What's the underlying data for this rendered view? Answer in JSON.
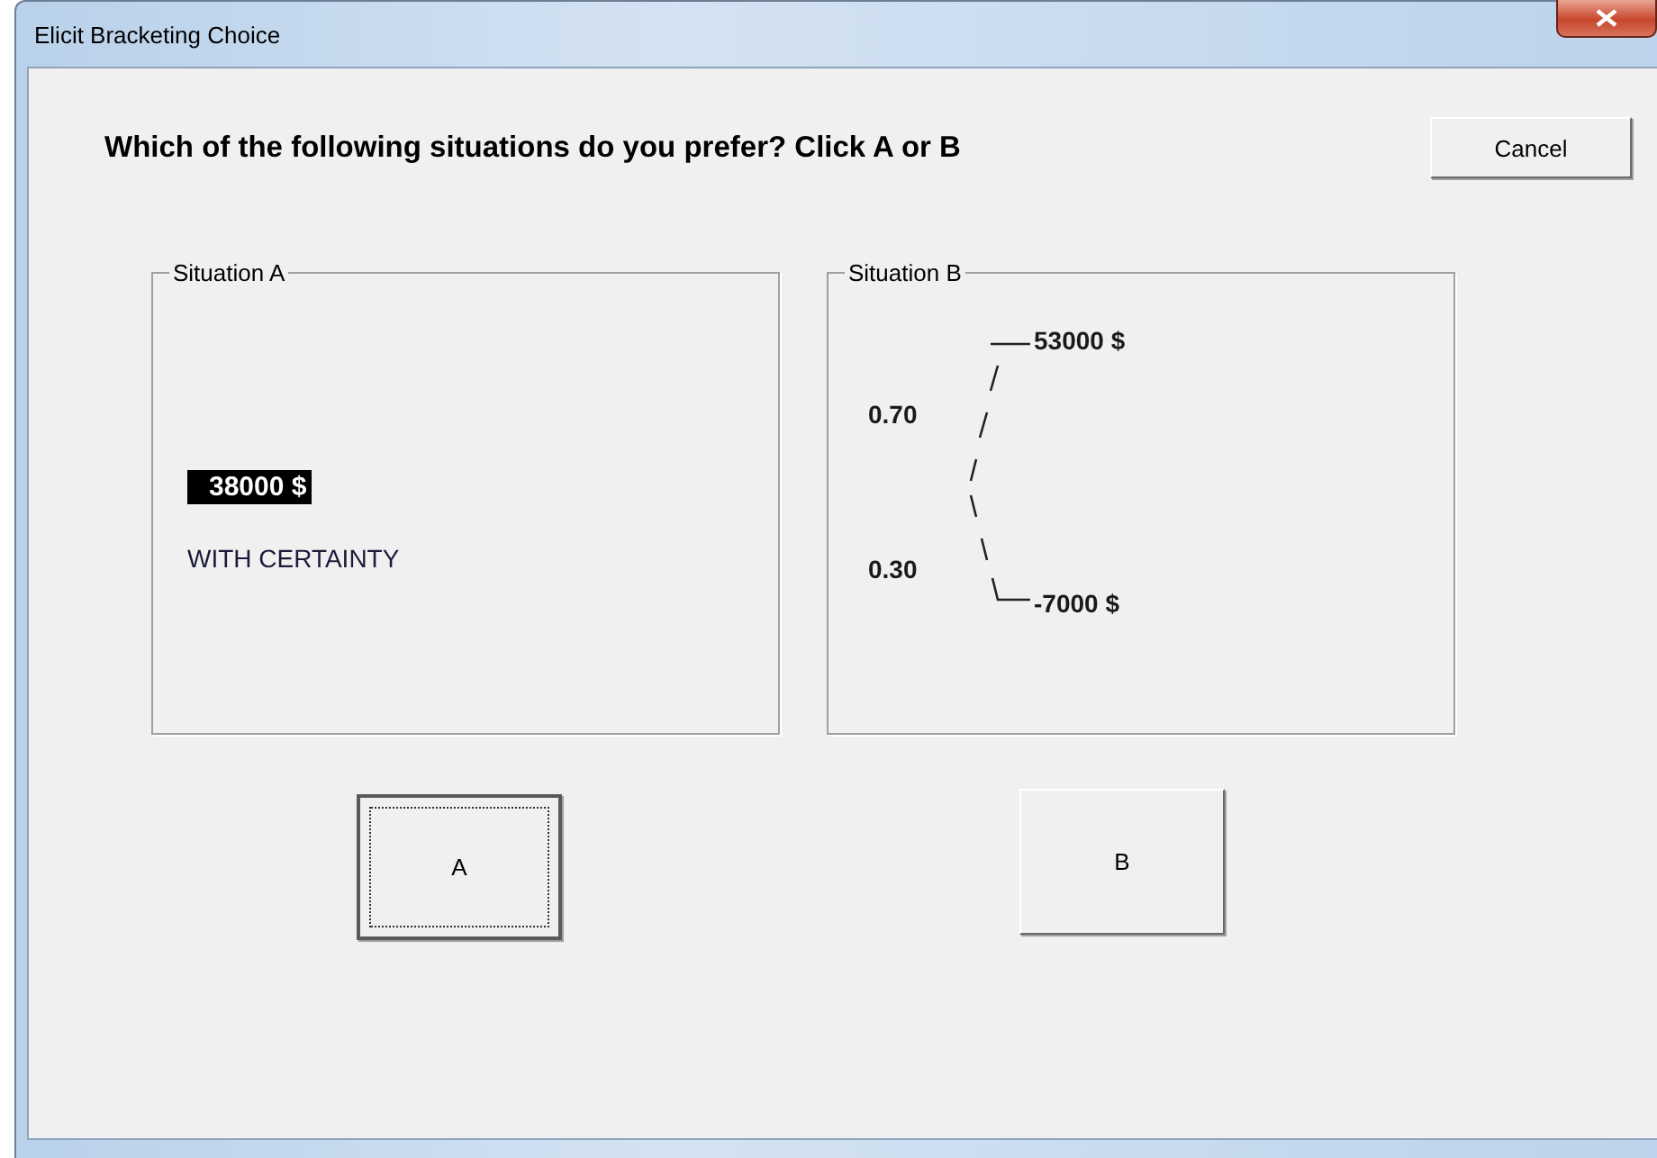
{
  "window": {
    "title": "Elicit Bracketing Choice"
  },
  "question": "Which of the following situations do you prefer?  Click A or B",
  "cancel_button": "Cancel",
  "situation_a": {
    "title": "Situation A",
    "amount": "38000 $",
    "amount_selected": true,
    "note": "WITH CERTAINTY"
  },
  "situation_b": {
    "title": "Situation B",
    "outcomes": [
      {
        "probability": "0.70",
        "amount": "53000 $"
      },
      {
        "probability": "0.30",
        "amount": "-7000 $"
      }
    ]
  },
  "choice_buttons": [
    {
      "label": "A",
      "focused": true
    },
    {
      "label": "B",
      "focused": false
    }
  ]
}
